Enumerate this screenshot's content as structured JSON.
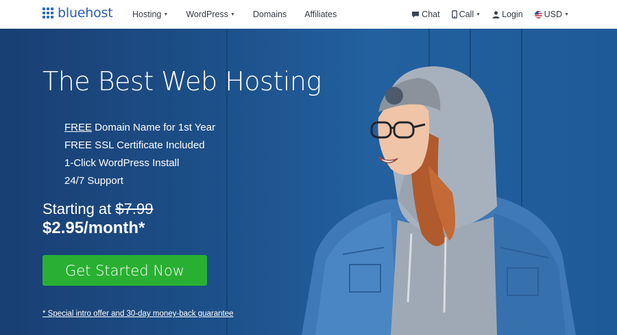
{
  "brand": {
    "name": "bluehost"
  },
  "nav": {
    "links": [
      {
        "label": "Hosting",
        "dropdown": true
      },
      {
        "label": "WordPress",
        "dropdown": true
      },
      {
        "label": "Domains",
        "dropdown": false
      },
      {
        "label": "Affiliates",
        "dropdown": false
      }
    ],
    "right": {
      "chat": "Chat",
      "call": "Call",
      "login": "Login",
      "currency": "USD"
    }
  },
  "hero": {
    "title": "The Best Web Hosting",
    "features": [
      {
        "pre": "FREE",
        "pre_underlined": true,
        "rest": " Domain Name for 1st Year"
      },
      {
        "pre": "FREE",
        "pre_underlined": false,
        "rest": " SSL Certificate Included"
      },
      {
        "pre": "1-Click",
        "pre_underlined": false,
        "rest": " WordPress Install"
      },
      {
        "pre": "24/7",
        "pre_underlined": false,
        "rest": " Support"
      }
    ],
    "starting_label": "Starting at",
    "old_price": "$7.99",
    "price": "$2.95/month*",
    "cta_label": "Get Started Now",
    "disclaimer": "* Special intro offer and 30-day money-back guarantee"
  },
  "colors": {
    "brand_blue": "#2f6fd4",
    "hero_bg": "#1d5089",
    "cta_green": "#29b032"
  },
  "icons": [
    "logo-grid-icon",
    "chat-icon",
    "phone-icon",
    "user-icon",
    "us-flag-icon",
    "chevron-down-icon"
  ]
}
